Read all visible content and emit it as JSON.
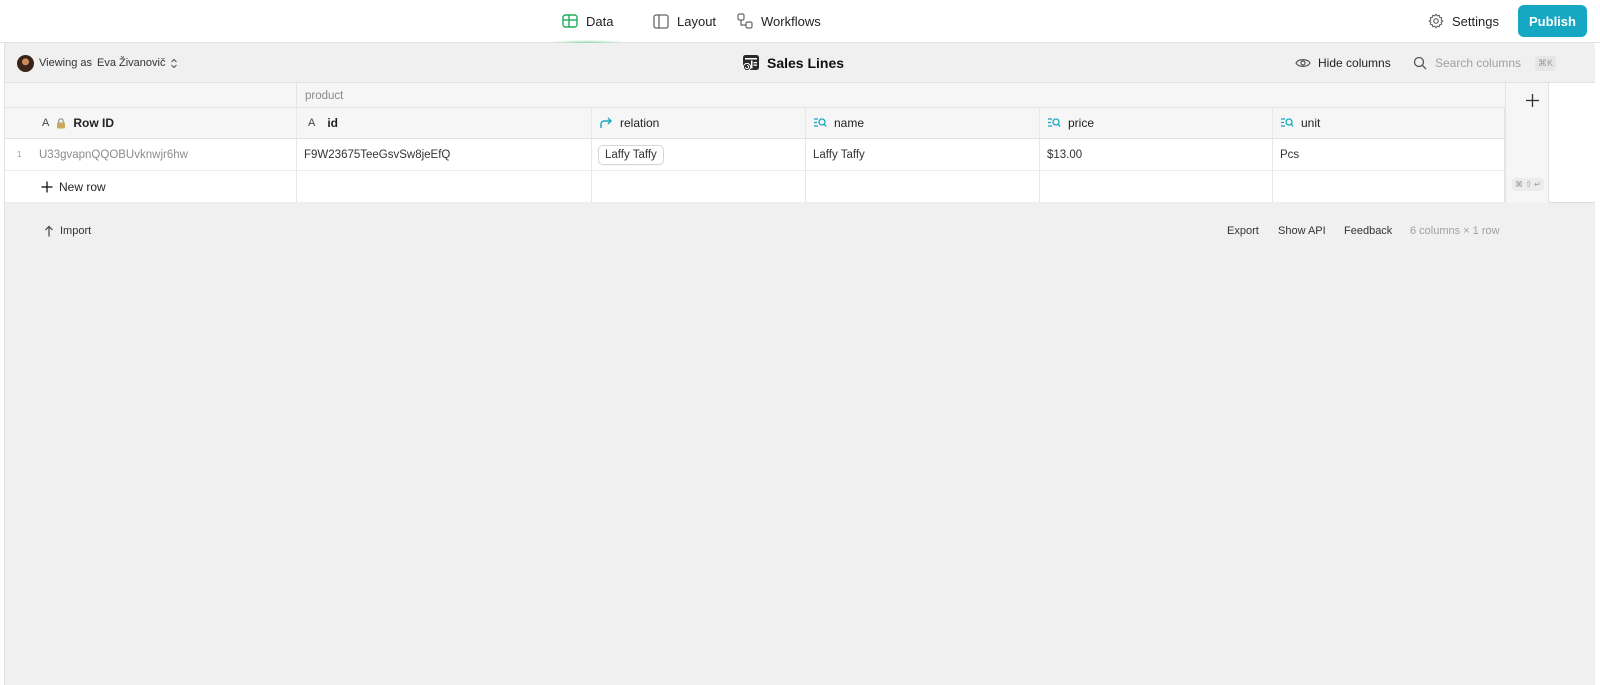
{
  "topnav": {
    "tabs": [
      {
        "label": "Data",
        "icon": "table-icon",
        "active": true
      },
      {
        "label": "Layout",
        "icon": "layout-icon",
        "active": false
      },
      {
        "label": "Workflows",
        "icon": "workflows-icon",
        "active": false
      }
    ],
    "settings_label": "Settings",
    "publish_label": "Publish",
    "accent_color": "#16a8c2",
    "active_tab_glow": "#3cc86e"
  },
  "toolbar": {
    "viewing_as_prefix": "Viewing as",
    "viewing_as_user": "Eva Živanovič",
    "table_title": "Sales Lines",
    "hide_columns_label": "Hide columns",
    "search_placeholder": "Search columns",
    "search_shortcut": "⌘K"
  },
  "grid": {
    "group_label": "product",
    "columns": [
      {
        "label": "Row ID",
        "icon": "text-icon",
        "locked": true
      },
      {
        "label": "id",
        "icon": "text-icon"
      },
      {
        "label": "relation",
        "icon": "relation-icon"
      },
      {
        "label": "name",
        "icon": "lookup-icon"
      },
      {
        "label": "price",
        "icon": "lookup-icon"
      },
      {
        "label": "unit",
        "icon": "lookup-icon"
      }
    ],
    "rows": [
      {
        "num": "1",
        "row_id": "U33gvapnQQOBUvknwjr6hw",
        "id": "F9W23675TeeGsvSw8jeEfQ",
        "relation": "Laffy Taffy",
        "name": "Laffy Taffy",
        "price": "$13.00",
        "unit": "Pcs"
      }
    ],
    "new_row_label": "New row",
    "new_row_shortcut": "⌘ ⇧ ↵"
  },
  "footer": {
    "import_label": "Import",
    "export_label": "Export",
    "show_api_label": "Show API",
    "feedback_label": "Feedback",
    "summary": "6 columns × 1 row"
  }
}
